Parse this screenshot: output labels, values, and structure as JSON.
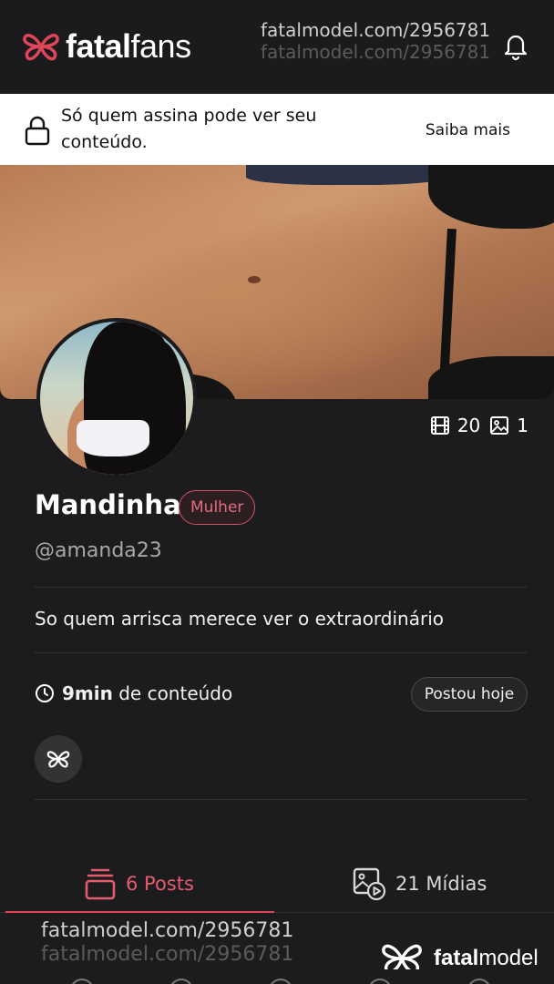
{
  "header": {
    "logo_bold": "fatal",
    "logo_light": "fans",
    "bell_icon": "bell-icon",
    "watermark": "fatalmodel.com/2956781"
  },
  "banner": {
    "lock_icon": "lock-icon",
    "message": "Só quem assina pode ver seu conteúdo.",
    "link": "Saiba mais"
  },
  "stats": {
    "videos": "20",
    "photos": "1",
    "video_icon": "film-icon",
    "photo_icon": "image-icon"
  },
  "profile": {
    "name": "Mandinha",
    "gender": "Mulher",
    "handle": "@amanda23",
    "bio": "So quem arrisca merece ver o extraordinário",
    "duration_value": "9min",
    "duration_suffix": "de conteúdo",
    "posted": "Postou hoje"
  },
  "tabs": [
    {
      "label": "6 Posts",
      "icon": "stack-icon",
      "active": true
    },
    {
      "label": "21 Mídias",
      "icon": "media-play-icon",
      "active": false
    }
  ],
  "footer": {
    "watermark": "fatalmodel.com/2956781",
    "brand_bold": "fatal",
    "brand_light": "model"
  },
  "colors": {
    "accent": "#e0455a",
    "background": "#1c1c1e",
    "banner": "#ffffff"
  }
}
